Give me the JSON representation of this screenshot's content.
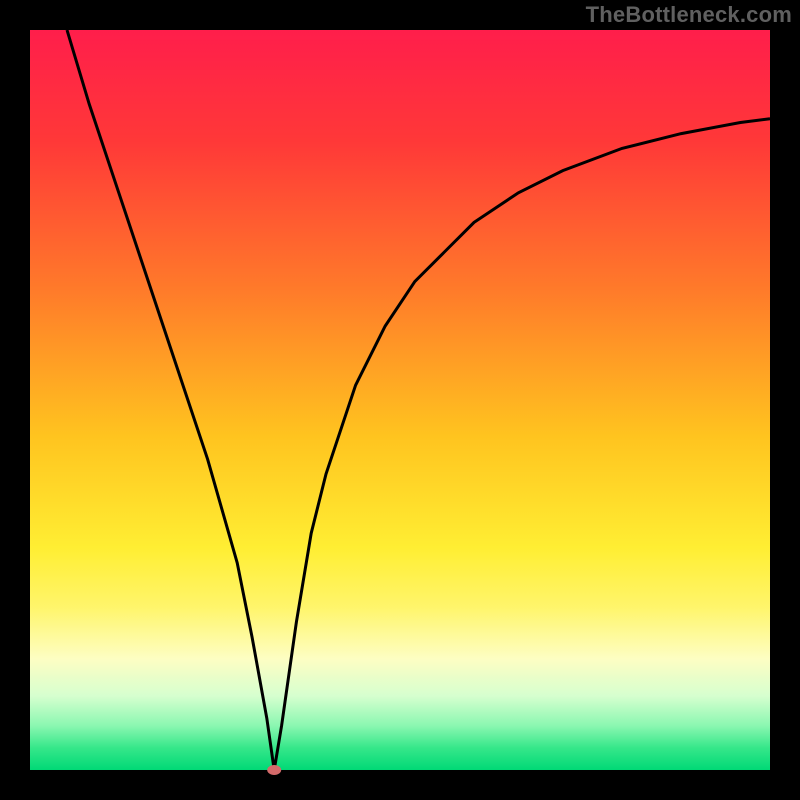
{
  "watermark": "TheBottleneck.com",
  "chart_data": {
    "type": "line",
    "title": "",
    "xlabel": "",
    "ylabel": "",
    "xlim": [
      0,
      100
    ],
    "ylim": [
      0,
      100
    ],
    "grid": false,
    "background_gradient": {
      "stops": [
        {
          "offset": 0.0,
          "color": "#ff1e4b"
        },
        {
          "offset": 0.15,
          "color": "#ff3838"
        },
        {
          "offset": 0.35,
          "color": "#ff7a2a"
        },
        {
          "offset": 0.55,
          "color": "#ffc41f"
        },
        {
          "offset": 0.7,
          "color": "#ffee33"
        },
        {
          "offset": 0.78,
          "color": "#fff56b"
        },
        {
          "offset": 0.85,
          "color": "#fdfec3"
        },
        {
          "offset": 0.9,
          "color": "#d6ffcf"
        },
        {
          "offset": 0.94,
          "color": "#8bf7b1"
        },
        {
          "offset": 0.97,
          "color": "#36e78a"
        },
        {
          "offset": 1.0,
          "color": "#00d976"
        }
      ]
    },
    "min_marker": {
      "x": 33,
      "y": 0,
      "color": "#d46a6a"
    },
    "series": [
      {
        "name": "curve",
        "color": "#000000",
        "x": [
          5,
          8,
          12,
          16,
          20,
          24,
          28,
          30,
          32,
          33,
          34,
          36,
          38,
          40,
          44,
          48,
          52,
          56,
          60,
          66,
          72,
          80,
          88,
          96,
          100
        ],
        "y": [
          100,
          90,
          78,
          66,
          54,
          42,
          28,
          18,
          7,
          0,
          6,
          20,
          32,
          40,
          52,
          60,
          66,
          70,
          74,
          78,
          81,
          84,
          86,
          87.5,
          88
        ]
      }
    ]
  }
}
